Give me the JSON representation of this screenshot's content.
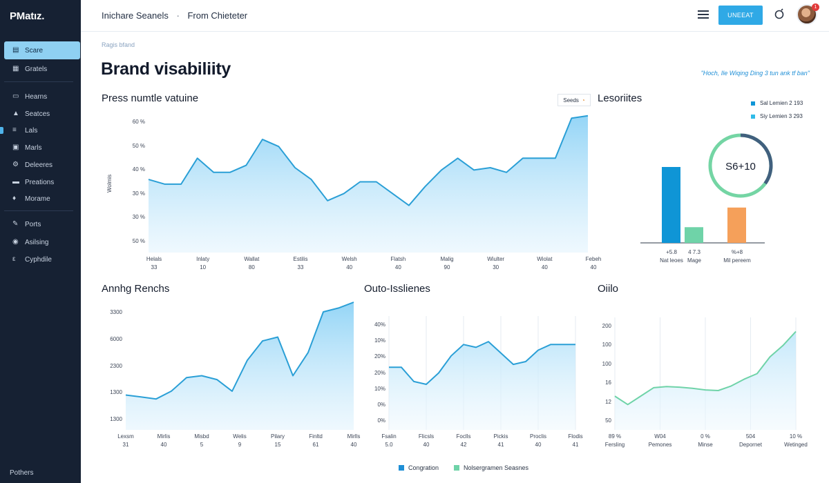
{
  "sidebar": {
    "brand": "PMatız.",
    "items": [
      {
        "label": "Scare",
        "icon": "folder-icon",
        "active": true
      },
      {
        "label": "Gratels",
        "icon": "grid-icon",
        "active": false
      },
      {
        "label": "Hearns",
        "icon": "document-icon",
        "active": false
      },
      {
        "label": "Seatces",
        "icon": "bell-icon",
        "active": false
      },
      {
        "label": "Lals",
        "icon": "list-icon",
        "active": false
      },
      {
        "label": "Marls",
        "icon": "clipboard-icon",
        "active": false
      },
      {
        "label": "Deleeres",
        "icon": "gear-icon",
        "active": false
      },
      {
        "label": "Preations",
        "icon": "chart-icon",
        "active": false
      },
      {
        "label": "Morame",
        "icon": "pin-icon",
        "active": false
      },
      {
        "label": "Ports",
        "icon": "pencil-icon",
        "active": false
      },
      {
        "label": "Asilsing",
        "icon": "settings-icon",
        "active": false
      },
      {
        "label": "Cyphdile",
        "icon": "user-icon",
        "active": false
      }
    ],
    "footer": "Pothers"
  },
  "header": {
    "crumb_1": "Inichare Seanels",
    "crumb_sep": "·",
    "crumb_2": "From Chieteter",
    "cta_label": "UNEEAT",
    "badge": "1"
  },
  "main": {
    "subcrumb": "Ragis bfand",
    "title": "Brand visabiliity",
    "promo_link": "\"Hoch, Ile Wiqing Ding 3 tun ank tf ban\""
  },
  "panels": {
    "line_title": "Press numtle vatuine",
    "select_label": "Seeds",
    "bars_title": "Lesoriites",
    "bottom_left_title": "Annhg Renchs",
    "bottom_mid_title": "Outo-Isslienes",
    "bottom_right_title": "Oiilo"
  },
  "colors": {
    "accent": "#2fa9e6",
    "line": "#2a9fd6",
    "fill": "#bfe6fa",
    "bar_blue": "#0f95d6",
    "bar_green": "#6fd3a8",
    "bar_orange": "#f5a05a",
    "donut_green": "#74d5a4",
    "donut_dark": "#41607e",
    "green_line": "#6fd3a8"
  },
  "bottom_legend": [
    {
      "label": "Congration",
      "color": "#1f8fd6"
    },
    {
      "label": "Nolsergramen Seasnes",
      "color": "#6fd3a8"
    }
  ],
  "chart_data": [
    {
      "type": "area",
      "title": "Press numtle vatuine",
      "ylabel": "Wolmis",
      "y_ticks": [
        "60 %",
        "50 %",
        "40 %",
        "30 %",
        "30 %",
        "50 %"
      ],
      "x_labels": [
        {
          "top": "Helals",
          "bottom": "33"
        },
        {
          "top": "Inlaty",
          "bottom": "10"
        },
        {
          "top": "Wallat",
          "bottom": "80"
        },
        {
          "top": "Estilis",
          "bottom": "33"
        },
        {
          "top": "Welsh",
          "bottom": "40"
        },
        {
          "top": "Flatsh",
          "bottom": "40"
        },
        {
          "top": "Malig",
          "bottom": "90"
        },
        {
          "top": "Wiulter",
          "bottom": "30"
        },
        {
          "top": "Wiolat",
          "bottom": "40"
        },
        {
          "top": "Febeh",
          "bottom": "40"
        }
      ],
      "ylim": [
        0,
        60
      ],
      "values": [
        31,
        29,
        29,
        40,
        34,
        34,
        37,
        48,
        45,
        36,
        31,
        22,
        25,
        30,
        30,
        25,
        20,
        28,
        35,
        40,
        35,
        36,
        34,
        40,
        40,
        40,
        57,
        58
      ]
    },
    {
      "type": "bar",
      "title": "Lesoriites",
      "legend": [
        {
          "label": "Sal Lemien 2 193",
          "color": "#0f95d6"
        },
        {
          "label": "Siy Lemien 3 293",
          "color": "#2fbbe8"
        }
      ],
      "categories": [
        {
          "value_label": "+5.8",
          "name": "Nat leoes"
        },
        {
          "value_label": "4 7.3",
          "name": "Mage"
        },
        {
          "value_label": "%+8",
          "name": "Mil pereem"
        }
      ],
      "values": [
        58,
        12,
        27
      ],
      "donut_label": "S6+10",
      "donut_fraction": 0.35
    },
    {
      "type": "area",
      "title": "Annhg Renchs",
      "y_ticks": [
        "3300",
        "6000",
        "2300",
        "1300",
        "1300"
      ],
      "x_labels": [
        {
          "top": "Lexsm",
          "bottom": "31"
        },
        {
          "top": "Mirlis",
          "bottom": "40"
        },
        {
          "top": "Misbd",
          "bottom": "5"
        },
        {
          "top": "Welis",
          "bottom": "9"
        },
        {
          "top": "Pilary",
          "bottom": "15"
        },
        {
          "top": "Finltd",
          "bottom": "61"
        },
        {
          "top": "Mirlls",
          "bottom": "40"
        }
      ],
      "ylim": [
        0,
        3300
      ],
      "values": [
        900,
        850,
        800,
        1000,
        1350,
        1400,
        1300,
        1000,
        1800,
        2300,
        2400,
        1400,
        2000,
        3050,
        3150,
        3300
      ]
    },
    {
      "type": "area",
      "title": "Outo-Isslienes",
      "y_ticks": [
        "40%",
        "10%",
        "20%",
        "20%",
        "10%",
        "0%",
        "0%"
      ],
      "x_labels": [
        {
          "top": "Fsalin",
          "bottom": "5.0"
        },
        {
          "top": "Flicsls",
          "bottom": "40"
        },
        {
          "top": "Foclls",
          "bottom": "42"
        },
        {
          "top": "Pickis",
          "bottom": "41"
        },
        {
          "top": "Proclis",
          "bottom": "40"
        },
        {
          "top": "Flodis",
          "bottom": "41"
        }
      ],
      "ylim": [
        0,
        40
      ],
      "values": [
        22,
        22,
        17,
        16,
        20,
        26,
        30,
        29,
        31,
        27,
        23,
        24,
        28,
        30,
        30,
        30
      ]
    },
    {
      "type": "area",
      "title": "Oiilo",
      "y_ticks": [
        "200",
        "100",
        "100",
        "16",
        "12",
        "50"
      ],
      "x_labels": [
        {
          "top": "89 %",
          "bottom": "Fersling"
        },
        {
          "top": "W04",
          "bottom": "Pemones"
        },
        {
          "top": "0 %",
          "bottom": "Minse"
        },
        {
          "top": "504",
          "bottom": "Depornet"
        },
        {
          "top": "10 %",
          "bottom": "Wetinged"
        }
      ],
      "ylim": [
        0,
        200
      ],
      "values": [
        60,
        45,
        60,
        75,
        77,
        76,
        74,
        71,
        70,
        78,
        90,
        100,
        130,
        150,
        175
      ]
    }
  ]
}
